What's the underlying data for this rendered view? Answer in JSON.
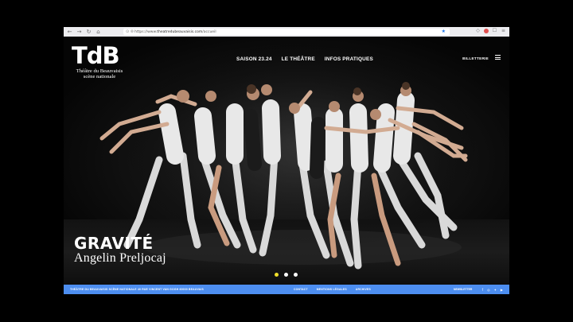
{
  "browser": {
    "url_prefix": "https://www.",
    "url_domain": "theatredubeauvaisis.com",
    "url_path": "/accueil",
    "back_icon": "arrow-left-icon",
    "forward_icon": "arrow-right-icon",
    "reload_icon": "reload-icon",
    "home_icon": "home-icon"
  },
  "header": {
    "logo_text": "TdB",
    "logo_sub_1": "Théâtre du Beauvaisis",
    "logo_sub_2": "scène nationale",
    "nav": [
      "SAISON 23.24",
      "LE THÉÂTRE",
      "INFOS PRATIQUES"
    ],
    "ticket_label": "BILLETTERIE",
    "menu_icon": "hamburger-icon"
  },
  "hero": {
    "title": "GRAVITÉ",
    "author": "Angelin Preljocaj",
    "slides_total": 3,
    "active_slide": 1,
    "active_dot_color": "#f0df2a"
  },
  "footer": {
    "background": "#4d8ef0",
    "address": "THÉÂTRE DU BEAUVAISIS SCÈNE NATIONALE 40 RUE VINCENT VAN GOGH 60000 BEAUVAIS",
    "links": [
      "CONTACT",
      "MENTIONS LÉGALES",
      "ARCHIVES"
    ],
    "newsletter": "NEWSLETTER",
    "socials": [
      "facebook-icon",
      "instagram-icon",
      "twitter-icon",
      "youtube-icon"
    ]
  }
}
